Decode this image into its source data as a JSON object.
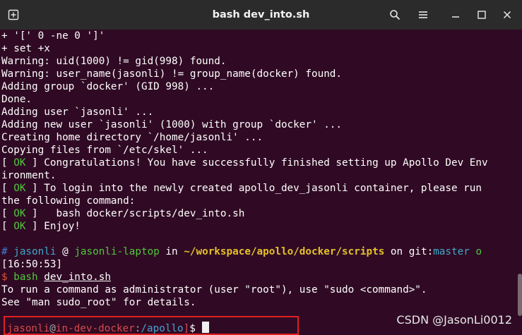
{
  "window": {
    "title": "bash dev_into.sh"
  },
  "titlebar": {
    "icons": [
      "new-tab-icon",
      "search-icon",
      "menu-icon",
      "minimize-icon",
      "maximize-icon",
      "close-icon"
    ]
  },
  "output": {
    "l1": "+ '[' 0 -ne 0 ']'",
    "l2": "+ set +x",
    "l3": "Warning: uid(1000) != gid(998) found.",
    "l4": "Warning: user_name(jasonli) != group_name(docker) found.",
    "l5": "Adding group `docker' (GID 998) ...",
    "l6": "Done.",
    "l7": "Adding user `jasonli' ...",
    "l8": "Adding new user `jasonli' (1000) with group `docker' ...",
    "l9": "Creating home directory `/home/jasonli' ...",
    "l10": "Copying files from `/etc/skel' ...",
    "ok_tag": "OK",
    "bracket_open": "[ ",
    "bracket_close": " ]",
    "ok1_text": " Congratulations! You have successfully finished setting up Apollo Dev Env",
    "ok1_wrap": "ironment.",
    "ok2_text": " To login into the newly created apollo_dev_jasonli container, please run",
    "ok2_wrap": "the following command:",
    "ok3_text": "   bash docker/scripts/dev_into.sh",
    "ok4_text": " Enjoy!"
  },
  "prompt": {
    "hash": "#",
    "user": "jasonli",
    "at": " @ ",
    "host": "jasonli-laptop",
    "in": " in ",
    "path": "~/workspace/apollo/docker/scripts",
    "on": " on git:",
    "branch": "master",
    "status": " o",
    "time": "[16:50:53]",
    "dollar": "$",
    "cmd_word": " bash ",
    "cmd_arg": "dev_into.sh"
  },
  "sudo_notice": {
    "l1": "To run a command as administrator (user \"root\"), use \"sudo <command>\".",
    "l2": "See \"man sudo_root\" for details."
  },
  "container_prompt": {
    "user": "jasonli",
    "at": "@",
    "host": "in-dev-docker",
    "colon": ":",
    "path": "/apollo",
    "sep": "]",
    "dollar": "$ "
  },
  "watermark": "CSDN @JasonLi0012"
}
